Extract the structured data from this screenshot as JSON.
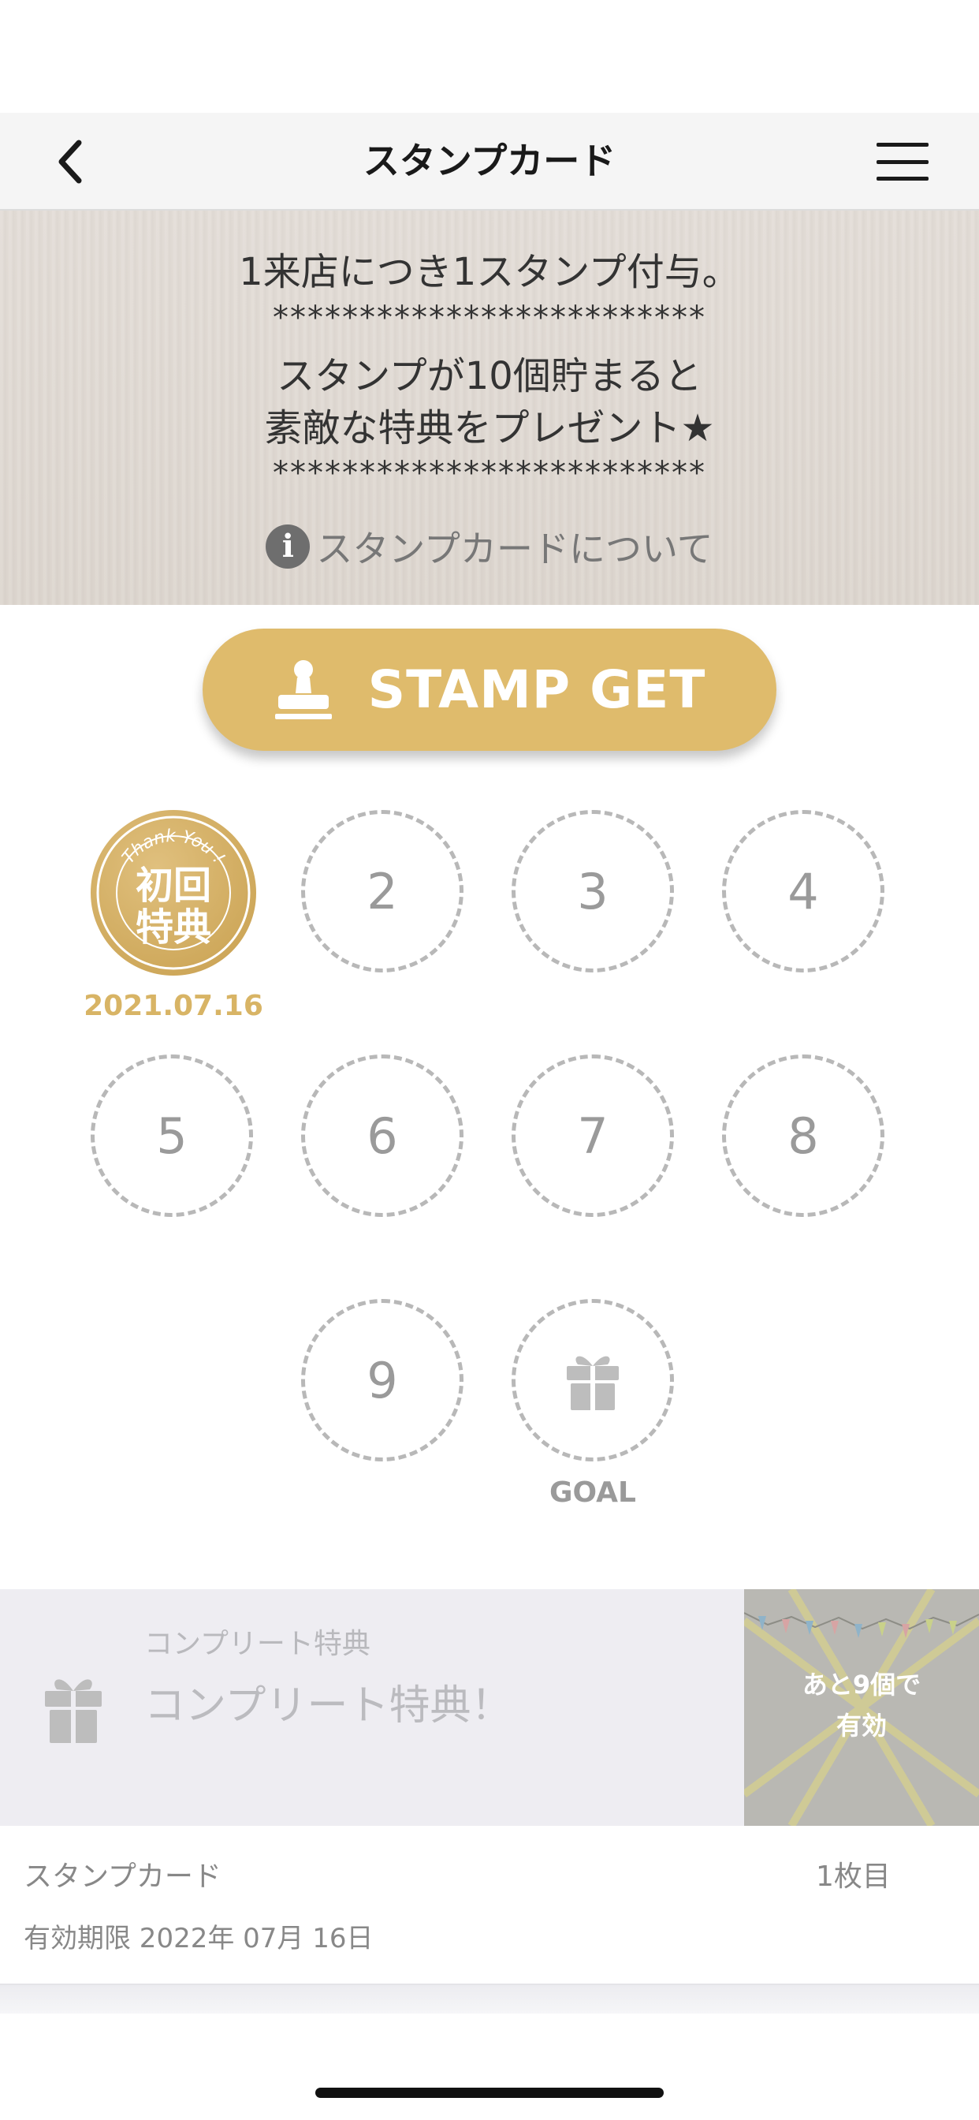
{
  "header": {
    "title": "スタンプカード",
    "back_icon": "chevron-left-icon",
    "menu_icon": "hamburger-menu-icon"
  },
  "banner": {
    "line1": "1来店につき1スタンプ付与。",
    "stars": "*************************",
    "line2": "スタンプが10個貯まると",
    "line3": "素敵な特典をプレゼント★",
    "about_link": "スタンプカードについて",
    "info_icon": "i"
  },
  "stamp_button": {
    "label": "STAMP GET",
    "icon": "stamp-icon",
    "color": "#dfbb6c"
  },
  "stamps": {
    "first": {
      "ribbon_text": "Thank You !",
      "line1": "初回",
      "line2": "特典",
      "date": "2021.07.16"
    },
    "numbers": [
      "2",
      "3",
      "4",
      "5",
      "6",
      "7",
      "8",
      "9"
    ],
    "goal_label": "GOAL",
    "goal_icon": "gift-icon",
    "accent_color": "#d8b465"
  },
  "reward": {
    "small_title": "コンプリート特典",
    "title": "コンプリート特典！",
    "icon": "gift-icon",
    "overlay_text_line1": "あと9個で",
    "overlay_text_line2": "有効"
  },
  "card": {
    "name": "スタンプカード",
    "count": "1枚目",
    "expiry": "有効期限 2022年 07月 16日"
  }
}
